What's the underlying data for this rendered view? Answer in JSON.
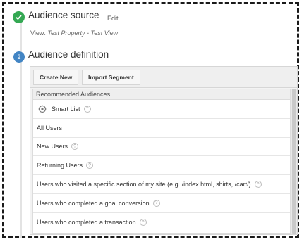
{
  "source_step": {
    "title": "Audience source",
    "edit_label": "Edit",
    "view_prefix": "View: ",
    "view_value": "Test Property - Test View"
  },
  "definition_step": {
    "number": "2",
    "title": "Audience definition"
  },
  "toolbar": {
    "create_new": "Create New",
    "import_segment": "Import Segment"
  },
  "list": {
    "header": "Recommended Audiences",
    "items": [
      {
        "label": "Smart List",
        "help": "?"
      },
      {
        "label": "All Users"
      },
      {
        "label": "New Users",
        "help": "?"
      },
      {
        "label": "Returning Users",
        "help": "?"
      },
      {
        "label": "Users who visited a specific section of my site (e.g. /index.html, shirts, /cart/)",
        "help": "?"
      },
      {
        "label": "Users who completed a goal conversion",
        "help": "?"
      },
      {
        "label": "Users who completed a transaction",
        "help": "?"
      }
    ]
  },
  "colors": {
    "check_green": "#34a853",
    "step_blue": "#4285c4"
  }
}
